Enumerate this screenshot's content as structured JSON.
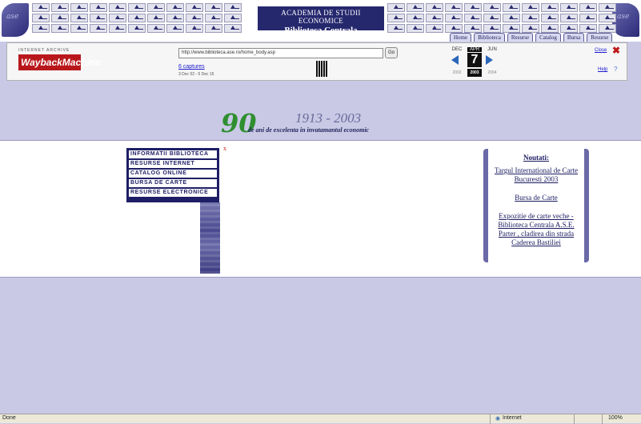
{
  "header": {
    "title_line1": "ACADEMIA DE STUDII ECONOMICE",
    "title_line2": "Biblioteca Centrala",
    "nav_tabs": [
      "Home",
      "Biblioteca",
      "Resurse",
      "Catalog",
      "Bursa",
      "Resurse"
    ]
  },
  "wayback": {
    "logo_top": "INTERNET ARCHIVE",
    "logo": "WaybackMachine",
    "url": "http://www.biblioteca.ase.ro/home_body.asp",
    "go_label": "Go",
    "captures": "6 captures",
    "range": "3 Dec 02 - 5 Dec 15",
    "prev_month": "DEC",
    "current_month": "APR",
    "next_month": "JUN",
    "day": "7",
    "prev_year": "2002",
    "current_year": "2003",
    "next_year": "2004",
    "close_label": "Close",
    "help_label": "Help",
    "help_icon": "?"
  },
  "anniversary": {
    "number": "90",
    "years": "1913 - 2003",
    "text": "de ani de excelenta in invatamantul economic"
  },
  "menu": {
    "items": [
      "INFORMATII BIBLIOTECA",
      "RESURSE INTERNET",
      "CATALOG ONLINE",
      "BURSA DE CARTE",
      "RESURSE ELECTRONICE"
    ],
    "close_icon": "x"
  },
  "news": {
    "title": "Noutati:",
    "item1_line1": "Targul International de Carte",
    "item1_line2": "Bucuresti 2003",
    "item2": "Bursa de Carte",
    "item3_line1": "Expozitie de carte veche -",
    "item3_line2": "Biblioteca Centrala A.S.E.",
    "item3_line3": "Parter , cladirea din strada",
    "item3_line4": "Caderea Bastiliei"
  },
  "statusbar": {
    "text": "Done",
    "zone": "Internet",
    "zoom": "100%"
  },
  "colors": {
    "page_bg": "#c9c9e6",
    "title_bg": "#26286e",
    "anniversary_number": "#2f8f2f",
    "menu_bg": "#1e1e66",
    "wayback_logo": "#b8181c"
  },
  "icons": {
    "close": "close-icon",
    "prev": "arrow-left-icon",
    "next": "arrow-right-icon",
    "help": "help-icon",
    "internet_zone": "globe-icon"
  }
}
